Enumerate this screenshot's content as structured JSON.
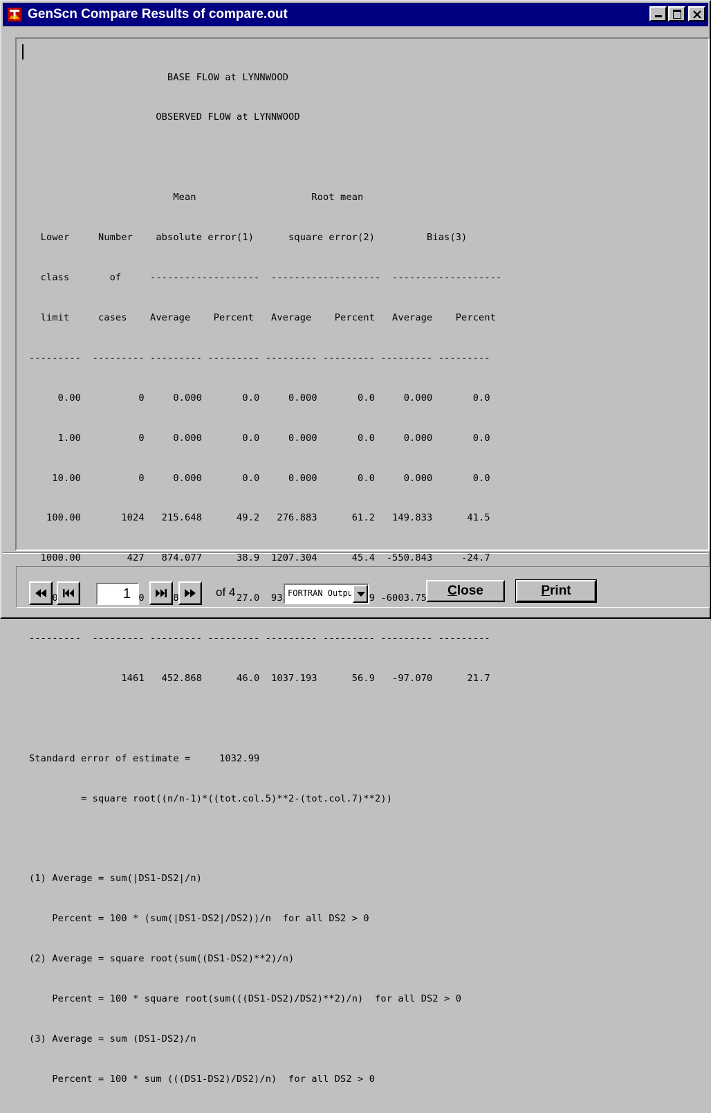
{
  "window": {
    "title": "GenScn Compare Results of compare.out"
  },
  "report": {
    "lines": [
      "                        BASE FLOW at LYNNWOOD",
      "                      OBSERVED FLOW at LYNNWOOD",
      "",
      "                         Mean                    Root mean",
      "  Lower     Number    absolute error(1)      square error(2)         Bias(3)",
      "  class       of     -------------------  -------------------  -------------------",
      "  limit     cases    Average    Percent   Average    Percent   Average    Percent",
      "---------  --------- --------- --------- --------- --------- --------- ---------",
      "     0.00          0     0.000       0.0     0.000       0.0     0.000       0.0",
      "     1.00          0     0.000       0.0     0.000       0.0     0.000       0.0",
      "    10.00          0     0.000       0.0     0.000       0.0     0.000       0.0",
      "   100.00       1024   215.648      49.2   276.883      61.2   149.833      41.5",
      "  1000.00        427   874.077      38.9  1207.304      45.4  -550.843     -24.7",
      " 10000.00         10  6758.550      27.0  9331.697      28.9 -6003.754     -19.5",
      "---------  --------- --------- --------- --------- --------- --------- ---------",
      "                1461   452.868      46.0  1037.193      56.9   -97.070      21.7",
      "",
      "Standard error of estimate =     1032.99",
      "         = square root((n/n-1)*((tot.col.5)**2-(tot.col.7)**2))",
      "",
      "(1) Average = sum(|DS1-DS2|/n)",
      "    Percent = 100 * (sum(|DS1-DS2|/DS2))/n  for all DS2 > 0",
      "(2) Average = square root(sum((DS1-DS2)**2)/n)",
      "    Percent = 100 * square root(sum(((DS1-DS2)/DS2)**2)/n)  for all DS2 > 0",
      "(3) Average = sum (DS1-DS2)/n",
      "    Percent = 100 * sum (((DS1-DS2)/DS2)/n)  for all DS2 > 0"
    ]
  },
  "navigation": {
    "current_page": "1",
    "of_label": "of 4"
  },
  "output_format": {
    "selected": "FORTRAN Output"
  },
  "buttons": {
    "close_label": "lose",
    "close_mnemonic": "C",
    "print_label": "rint",
    "print_mnemonic": "P"
  },
  "icons": {
    "app": "genscn-app-icon",
    "first": "rewind-first-icon",
    "prev": "skip-previous-icon",
    "next": "skip-next-icon",
    "last": "fast-forward-last-icon"
  }
}
